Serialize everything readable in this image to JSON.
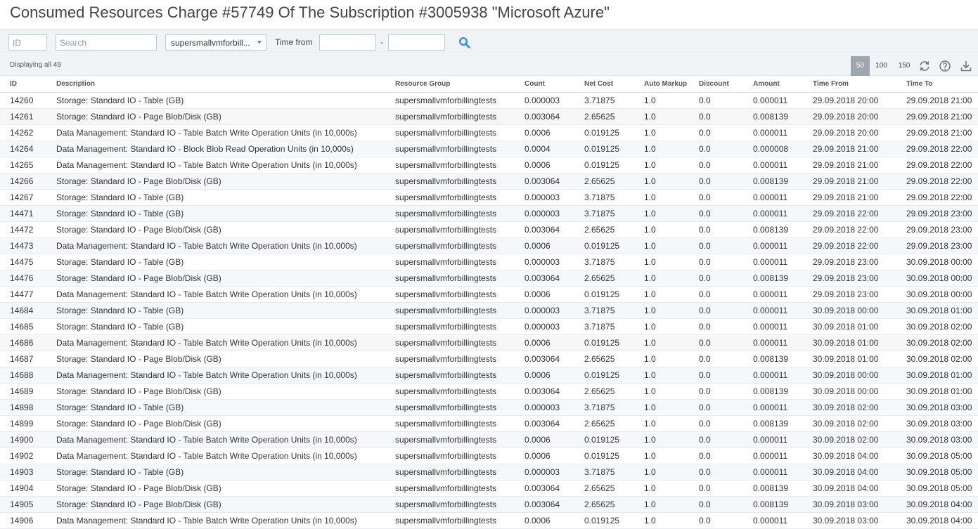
{
  "page": {
    "title": "Consumed Resources Charge #57749 Of The Subscription #3005938 \"Microsoft Azure\""
  },
  "filters": {
    "id_placeholder": "ID",
    "search_placeholder": "Search",
    "resource_group_value": "supersmallvmforbill...",
    "time_from_label": "Time from",
    "range_separator": "-",
    "search_icon": "magnifier-icon"
  },
  "toolbar": {
    "displaying": "Displaying all 49",
    "page_sizes": [
      "50",
      "100",
      "150"
    ],
    "active_page_size": "50",
    "icons": [
      "refresh-icon",
      "help-icon",
      "download-icon"
    ]
  },
  "table": {
    "columns": [
      "ID",
      "Description",
      "Resource Group",
      "Count",
      "Net Cost",
      "Auto Markup",
      "Discount",
      "Amount",
      "Time From",
      "Time To"
    ],
    "rows": [
      [
        "14260",
        "Storage: Standard IO - Table (GB)",
        "supersmallvmforbillingtests",
        "0.000003",
        "3.71875",
        "1.0",
        "0.0",
        "0.000011",
        "29.09.2018 20:00",
        "29.09.2018 21:00"
      ],
      [
        "14261",
        "Storage: Standard IO - Page Blob/Disk (GB)",
        "supersmallvmforbillingtests",
        "0.003064",
        "2.65625",
        "1.0",
        "0.0",
        "0.008139",
        "29.09.2018 20:00",
        "29.09.2018 21:00"
      ],
      [
        "14262",
        "Data Management: Standard IO - Table Batch Write Operation Units (in 10,000s)",
        "supersmallvmforbillingtests",
        "0.0006",
        "0.019125",
        "1.0",
        "0.0",
        "0.000011",
        "29.09.2018 20:00",
        "29.09.2018 21:00"
      ],
      [
        "14264",
        "Data Management: Standard IO - Block Blob Read Operation Units (in 10,000s)",
        "supersmallvmforbillingtests",
        "0.0004",
        "0.019125",
        "1.0",
        "0.0",
        "0.000008",
        "29.09.2018 21:00",
        "29.09.2018 22:00"
      ],
      [
        "14265",
        "Data Management: Standard IO - Table Batch Write Operation Units (in 10,000s)",
        "supersmallvmforbillingtests",
        "0.0006",
        "0.019125",
        "1.0",
        "0.0",
        "0.000011",
        "29.09.2018 21:00",
        "29.09.2018 22:00"
      ],
      [
        "14266",
        "Storage: Standard IO - Page Blob/Disk (GB)",
        "supersmallvmforbillingtests",
        "0.003064",
        "2.65625",
        "1.0",
        "0.0",
        "0.008139",
        "29.09.2018 21:00",
        "29.09.2018 22:00"
      ],
      [
        "14267",
        "Storage: Standard IO - Table (GB)",
        "supersmallvmforbillingtests",
        "0.000003",
        "3.71875",
        "1.0",
        "0.0",
        "0.000011",
        "29.09.2018 21:00",
        "29.09.2018 22:00"
      ],
      [
        "14471",
        "Storage: Standard IO - Table (GB)",
        "supersmallvmforbillingtests",
        "0.000003",
        "3.71875",
        "1.0",
        "0.0",
        "0.000011",
        "29.09.2018 22:00",
        "29.09.2018 23:00"
      ],
      [
        "14472",
        "Storage: Standard IO - Page Blob/Disk (GB)",
        "supersmallvmforbillingtests",
        "0.003064",
        "2.65625",
        "1.0",
        "0.0",
        "0.008139",
        "29.09.2018 22:00",
        "29.09.2018 23:00"
      ],
      [
        "14473",
        "Data Management: Standard IO - Table Batch Write Operation Units (in 10,000s)",
        "supersmallvmforbillingtests",
        "0.0006",
        "0.019125",
        "1.0",
        "0.0",
        "0.000011",
        "29.09.2018 22:00",
        "29.09.2018 23:00"
      ],
      [
        "14475",
        "Storage: Standard IO - Table (GB)",
        "supersmallvmforbillingtests",
        "0.000003",
        "3.71875",
        "1.0",
        "0.0",
        "0.000011",
        "29.09.2018 23:00",
        "30.09.2018 00:00"
      ],
      [
        "14476",
        "Storage: Standard IO - Page Blob/Disk (GB)",
        "supersmallvmforbillingtests",
        "0.003064",
        "2.65625",
        "1.0",
        "0.0",
        "0.008139",
        "29.09.2018 23:00",
        "30.09.2018 00:00"
      ],
      [
        "14477",
        "Data Management: Standard IO - Table Batch Write Operation Units (in 10,000s)",
        "supersmallvmforbillingtests",
        "0.0006",
        "0.019125",
        "1.0",
        "0.0",
        "0.000011",
        "29.09.2018 23:00",
        "30.09.2018 00:00"
      ],
      [
        "14684",
        "Storage: Standard IO - Table (GB)",
        "supersmallvmforbillingtests",
        "0.000003",
        "3.71875",
        "1.0",
        "0.0",
        "0.000011",
        "30.09.2018 00:00",
        "30.09.2018 01:00"
      ],
      [
        "14685",
        "Storage: Standard IO - Table (GB)",
        "supersmallvmforbillingtests",
        "0.000003",
        "3.71875",
        "1.0",
        "0.0",
        "0.000011",
        "30.09.2018 01:00",
        "30.09.2018 02:00"
      ],
      [
        "14686",
        "Data Management: Standard IO - Table Batch Write Operation Units (in 10,000s)",
        "supersmallvmforbillingtests",
        "0.0006",
        "0.019125",
        "1.0",
        "0.0",
        "0.000011",
        "30.09.2018 01:00",
        "30.09.2018 02:00"
      ],
      [
        "14687",
        "Storage: Standard IO - Page Blob/Disk (GB)",
        "supersmallvmforbillingtests",
        "0.003064",
        "2.65625",
        "1.0",
        "0.0",
        "0.008139",
        "30.09.2018 01:00",
        "30.09.2018 02:00"
      ],
      [
        "14688",
        "Data Management: Standard IO - Table Batch Write Operation Units (in 10,000s)",
        "supersmallvmforbillingtests",
        "0.0006",
        "0.019125",
        "1.0",
        "0.0",
        "0.000011",
        "30.09.2018 00:00",
        "30.09.2018 01:00"
      ],
      [
        "14689",
        "Storage: Standard IO - Page Blob/Disk (GB)",
        "supersmallvmforbillingtests",
        "0.003064",
        "2.65625",
        "1.0",
        "0.0",
        "0.008139",
        "30.09.2018 00:00",
        "30.09.2018 01:00"
      ],
      [
        "14898",
        "Storage: Standard IO - Table (GB)",
        "supersmallvmforbillingtests",
        "0.000003",
        "3.71875",
        "1.0",
        "0.0",
        "0.000011",
        "30.09.2018 02:00",
        "30.09.2018 03:00"
      ],
      [
        "14899",
        "Storage: Standard IO - Page Blob/Disk (GB)",
        "supersmallvmforbillingtests",
        "0.003064",
        "2.65625",
        "1.0",
        "0.0",
        "0.008139",
        "30.09.2018 02:00",
        "30.09.2018 03:00"
      ],
      [
        "14900",
        "Data Management: Standard IO - Table Batch Write Operation Units (in 10,000s)",
        "supersmallvmforbillingtests",
        "0.0006",
        "0.019125",
        "1.0",
        "0.0",
        "0.000011",
        "30.09.2018 02:00",
        "30.09.2018 03:00"
      ],
      [
        "14902",
        "Data Management: Standard IO - Table Batch Write Operation Units (in 10,000s)",
        "supersmallvmforbillingtests",
        "0.0006",
        "0.019125",
        "1.0",
        "0.0",
        "0.000011",
        "30.09.2018 04:00",
        "30.09.2018 05:00"
      ],
      [
        "14903",
        "Storage: Standard IO - Table (GB)",
        "supersmallvmforbillingtests",
        "0.000003",
        "3.71875",
        "1.0",
        "0.0",
        "0.000011",
        "30.09.2018 04:00",
        "30.09.2018 05:00"
      ],
      [
        "14904",
        "Storage: Standard IO - Page Blob/Disk (GB)",
        "supersmallvmforbillingtests",
        "0.003064",
        "2.65625",
        "1.0",
        "0.0",
        "0.008139",
        "30.09.2018 04:00",
        "30.09.2018 05:00"
      ],
      [
        "14905",
        "Storage: Standard IO - Page Blob/Disk (GB)",
        "supersmallvmforbillingtests",
        "0.003064",
        "2.65625",
        "1.0",
        "0.0",
        "0.008139",
        "30.09.2018 03:00",
        "30.09.2018 04:00"
      ],
      [
        "14906",
        "Data Management: Standard IO - Table Batch Write Operation Units (in 10,000s)",
        "supersmallvmforbillingtests",
        "0.0006",
        "0.019125",
        "1.0",
        "0.0",
        "0.000011",
        "30.09.2018 03:00",
        "30.09.2018 04:00"
      ]
    ]
  }
}
